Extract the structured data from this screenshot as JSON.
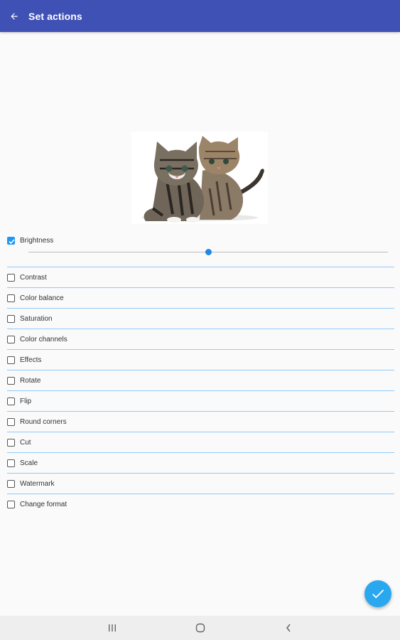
{
  "app_bar": {
    "title": "Set actions",
    "back_icon": "arrow-back-icon",
    "color": "#3f51b5"
  },
  "preview": {
    "image_icon": "kittens-photo"
  },
  "brightness": {
    "label": "Brightness",
    "checked": true,
    "slider_value_fraction": 0.5
  },
  "actions": [
    {
      "label": "Contrast",
      "checked": false
    },
    {
      "label": "Color balance",
      "checked": false
    },
    {
      "label": "Saturation",
      "checked": false
    },
    {
      "label": "Color channels",
      "checked": false
    },
    {
      "label": "Effects",
      "checked": false
    },
    {
      "label": "Rotate",
      "checked": false
    },
    {
      "label": "Flip",
      "checked": false
    },
    {
      "label": "Round corners",
      "checked": false
    },
    {
      "label": "Cut",
      "checked": false
    },
    {
      "label": "Scale",
      "checked": false
    },
    {
      "label": "Watermark",
      "checked": false
    },
    {
      "label": "Change format",
      "checked": false
    }
  ],
  "fab": {
    "icon": "checkmark-icon",
    "color": "#29a8f0"
  },
  "navigation_bar": {
    "icons": [
      "recent-apps-icon",
      "home-icon",
      "back-icon"
    ]
  }
}
